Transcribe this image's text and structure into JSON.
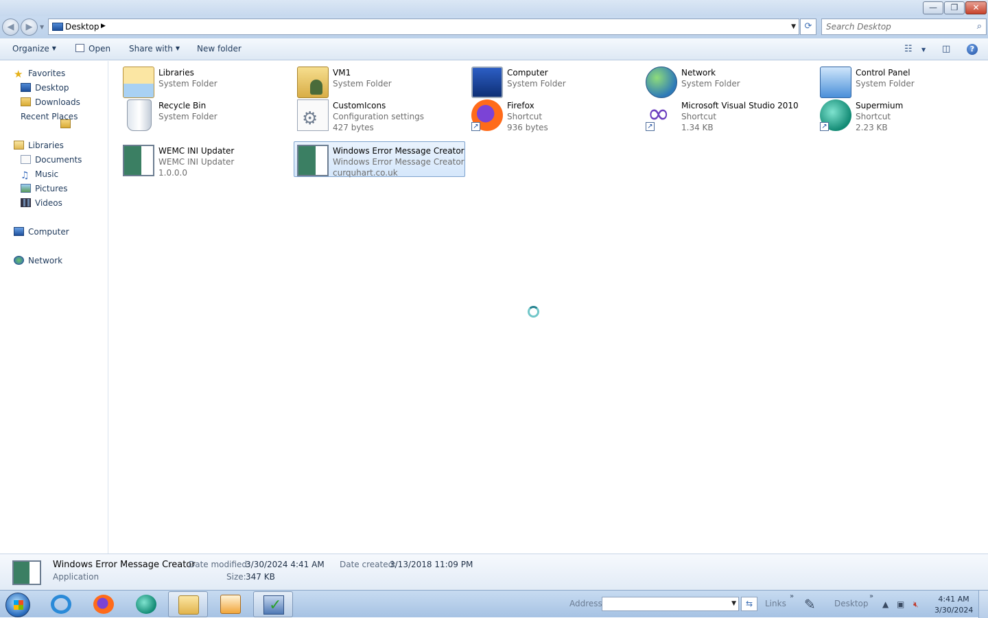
{
  "window": {
    "minimize_glyph": "—",
    "restore_glyph": "❐",
    "close_glyph": "✕"
  },
  "address": {
    "location": "Desktop",
    "search_placeholder": "Search Desktop"
  },
  "commands": {
    "organize": "Organize",
    "open": "Open",
    "share_with": "Share with",
    "new_folder": "New folder"
  },
  "nav": {
    "favorites": "Favorites",
    "desktop": "Desktop",
    "downloads": "Downloads",
    "recent_places": "Recent Places",
    "libraries": "Libraries",
    "documents": "Documents",
    "music": "Music",
    "pictures": "Pictures",
    "videos": "Videos",
    "computer": "Computer",
    "network": "Network"
  },
  "items": [
    {
      "name": "Libraries",
      "line2": "System Folder",
      "line3": ""
    },
    {
      "name": "VM1",
      "line2": "System Folder",
      "line3": ""
    },
    {
      "name": "Computer",
      "line2": "System Folder",
      "line3": ""
    },
    {
      "name": "Network",
      "line2": "System Folder",
      "line3": ""
    },
    {
      "name": "Control Panel",
      "line2": "System Folder",
      "line3": ""
    },
    {
      "name": "Recycle Bin",
      "line2": "System Folder",
      "line3": ""
    },
    {
      "name": "CustomIcons",
      "line2": "Configuration settings",
      "line3": "427 bytes"
    },
    {
      "name": "Firefox",
      "line2": "Shortcut",
      "line3": "936 bytes"
    },
    {
      "name": "Microsoft Visual Studio 2010",
      "line2": "Shortcut",
      "line3": "1.34 KB"
    },
    {
      "name": "Supermium",
      "line2": "Shortcut",
      "line3": "2.23 KB"
    },
    {
      "name": "WEMC INI Updater",
      "line2": "WEMC INI Updater",
      "line3": "1.0.0.0"
    },
    {
      "name": "Windows Error Message Creator",
      "line2": "Windows Error Message Creator",
      "line3": "curquhart.co.uk"
    }
  ],
  "details": {
    "name": "Windows Error Message Creator",
    "type": "Application",
    "date_modified_label": "Date modified:",
    "date_modified": "3/30/2024 4:41 AM",
    "size_label": "Size:",
    "size": "347 KB",
    "date_created_label": "Date created:",
    "date_created": "3/13/2018 11:09 PM"
  },
  "taskbar": {
    "address_label": "Address",
    "links_label": "Links",
    "desktop_label": "Desktop",
    "time": "4:41 AM",
    "date": "3/30/2024"
  }
}
